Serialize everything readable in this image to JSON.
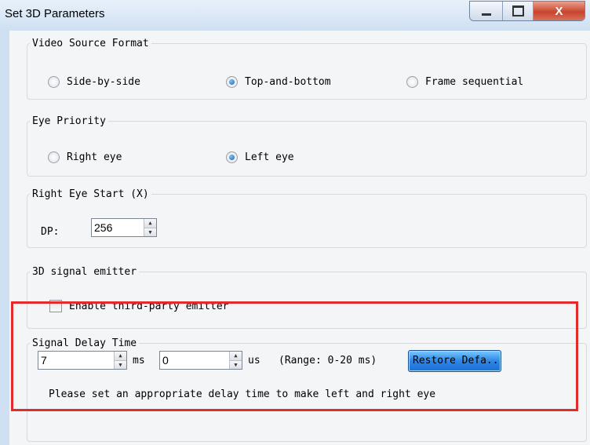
{
  "window": {
    "title": "Set 3D Parameters",
    "controls": {
      "minimize": "minimize",
      "maximize": "maximize",
      "close": "X"
    }
  },
  "video_source": {
    "legend": "Video Source Format",
    "options": [
      "Side-by-side",
      "Top-and-bottom",
      "Frame sequential"
    ],
    "selected": "Top-and-bottom"
  },
  "eye_priority": {
    "legend": "Eye Priority",
    "options": [
      "Right eye",
      "Left eye"
    ],
    "selected": "Left eye"
  },
  "right_eye_start": {
    "legend": "Right Eye Start (X)",
    "label": "DP:",
    "value": "256"
  },
  "emitter": {
    "legend": "3D signal emitter",
    "checkbox_label": "Enable third-party emitter",
    "checked": false
  },
  "signal_delay": {
    "legend": "Signal Delay Time",
    "ms_value": "7",
    "ms_unit": "ms",
    "us_value": "0",
    "us_unit": "us",
    "range_text": "(Range: 0-20 ms)",
    "restore_label": "Restore Defa...",
    "hint": "Please set an appropriate delay time to make left and right eye"
  },
  "colors": {
    "highlight": "#e32b2b",
    "restore_button": "#2e86e6",
    "close_button": "#c9442c"
  }
}
